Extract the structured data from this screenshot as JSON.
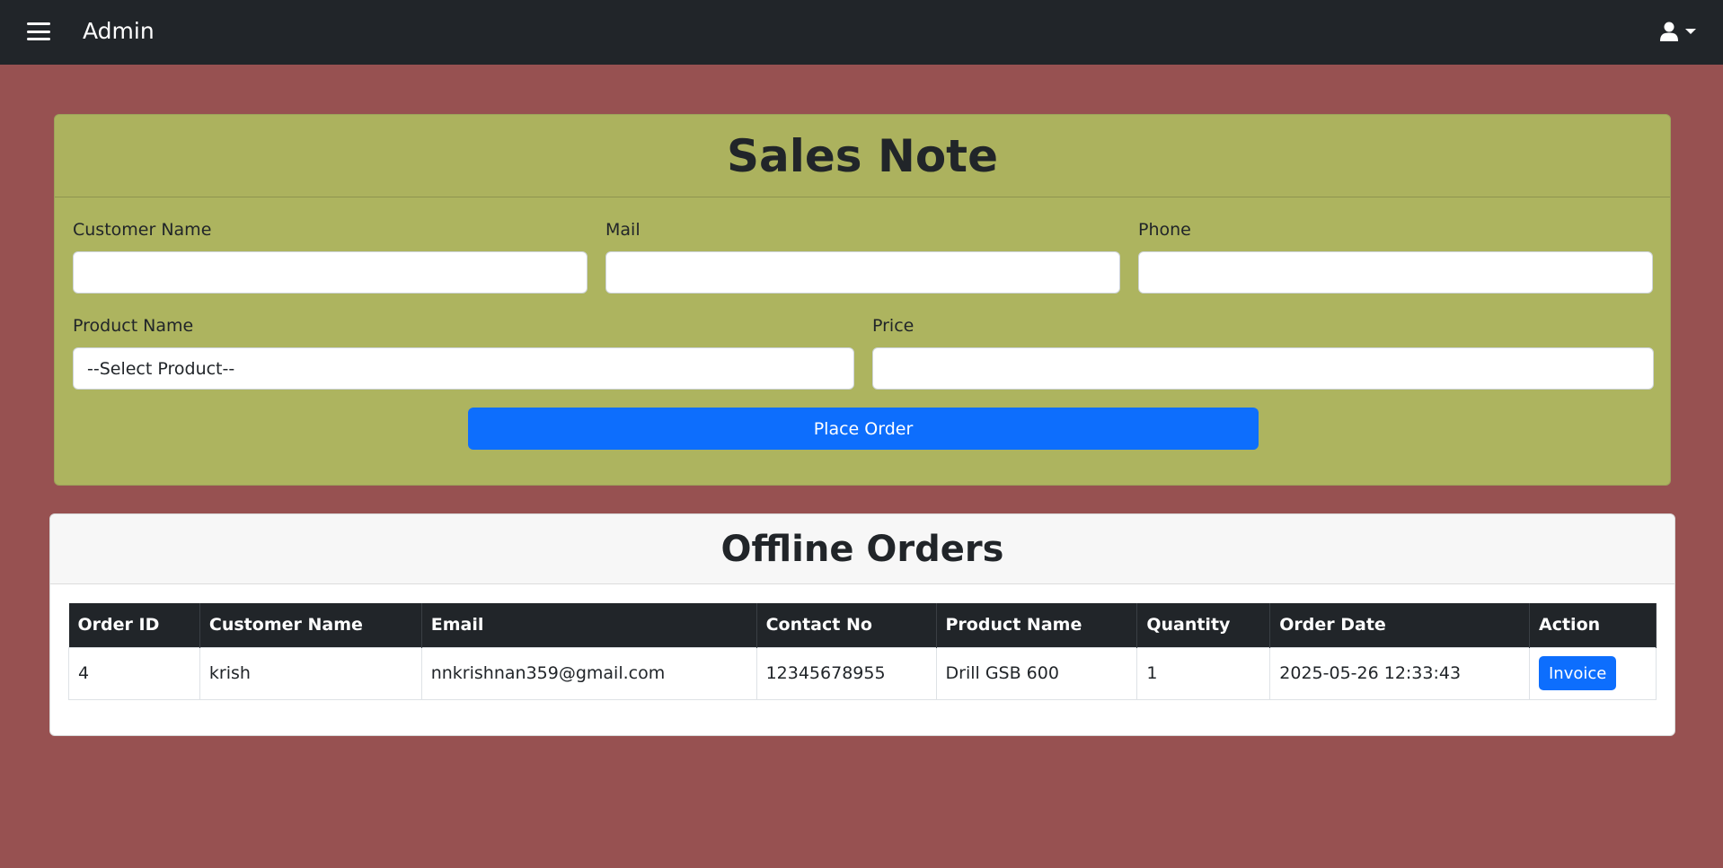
{
  "navbar": {
    "brand": "Admin",
    "menu_icon": "hamburger-menu-icon",
    "user_icon": "user-icon"
  },
  "sales_form": {
    "title": "Sales Note",
    "customer_name_label": "Customer Name",
    "customer_name_value": "",
    "mail_label": "Mail",
    "mail_value": "",
    "phone_label": "Phone",
    "phone_value": "",
    "product_name_label": "Product Name",
    "product_selected": "--Select Product--",
    "price_label": "Price",
    "price_value": "",
    "submit_label": "Place Order"
  },
  "orders": {
    "title": "Offline Orders",
    "columns": [
      "Order ID",
      "Customer Name",
      "Email",
      "Contact No",
      "Product Name",
      "Quantity",
      "Order Date",
      "Action"
    ],
    "rows": [
      {
        "order_id": "4",
        "customer_name": "krish",
        "email": "nnkrishnan359@gmail.com",
        "contact_no": "12345678955",
        "product_name": "Drill GSB 600",
        "quantity": "1",
        "order_date": "2025-05-26 12:33:43",
        "action_label": "Invoice"
      }
    ]
  },
  "colors": {
    "page_background": "#975151",
    "navbar": "#212529",
    "form_card": "#adb45f",
    "primary": "#0d6efd"
  }
}
